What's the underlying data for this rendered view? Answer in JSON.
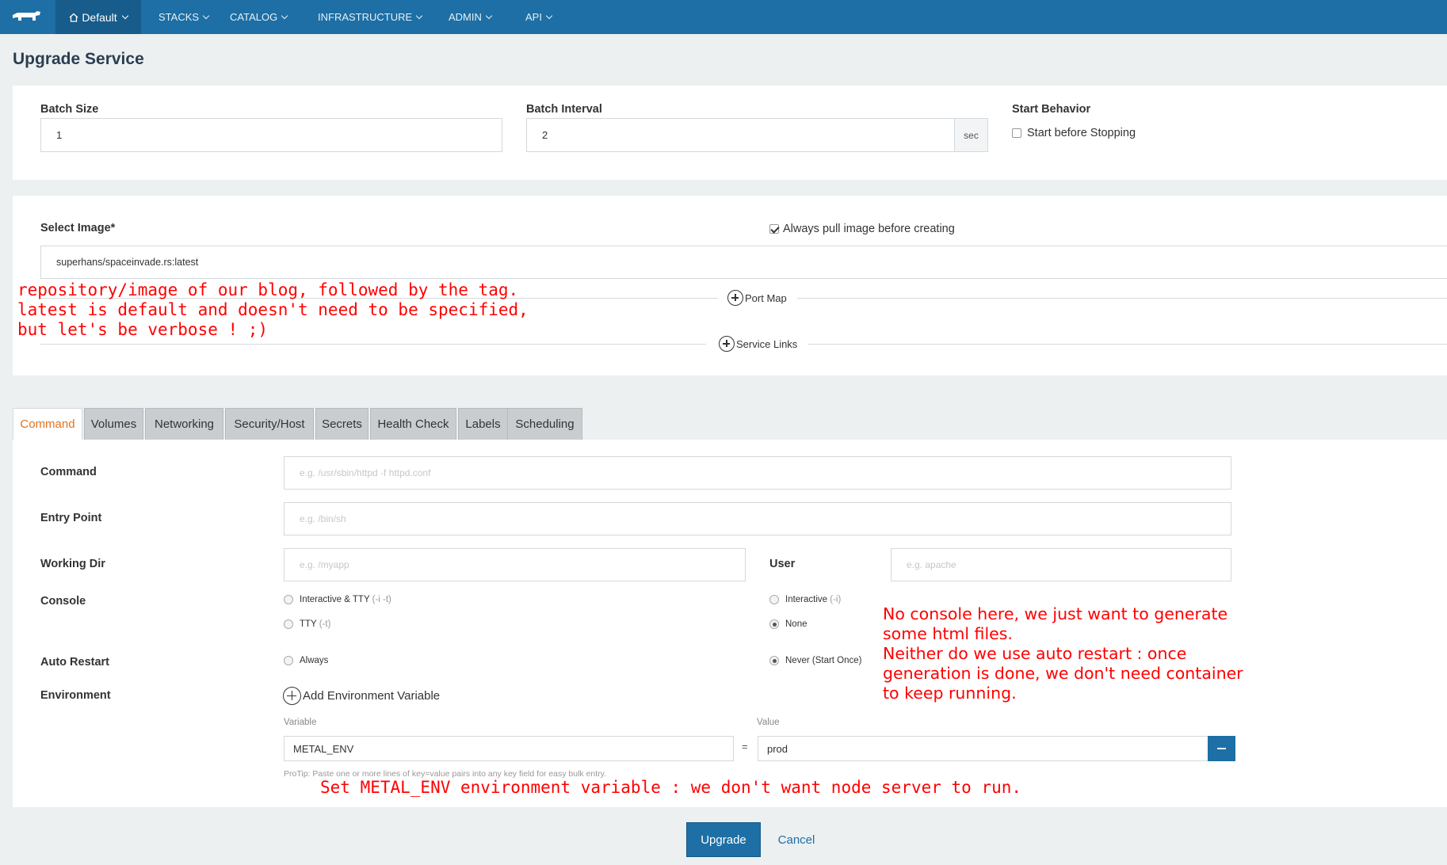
{
  "nav": {
    "environment": "Default",
    "items": [
      "STACKS",
      "CATALOG",
      "INFRASTRUCTURE",
      "ADMIN",
      "API"
    ]
  },
  "page_title": "Upgrade Service",
  "upgrade": {
    "batch_size_label": "Batch Size",
    "batch_size_value": "1",
    "batch_interval_label": "Batch Interval",
    "batch_interval_value": "2",
    "batch_interval_unit": "sec",
    "start_behavior_label": "Start Behavior",
    "start_before_stopping_label": "Start before Stopping",
    "start_before_stopping_checked": false
  },
  "image": {
    "label": "Select Image*",
    "value": "superhans/spaceinvade.rs:latest",
    "always_pull_label": "Always pull image before creating",
    "always_pull_checked": true,
    "port_map_label": "Port Map",
    "service_links_label": "Service Links"
  },
  "tabs": [
    "Command",
    "Volumes",
    "Networking",
    "Security/Host",
    "Secrets",
    "Health Check",
    "Labels",
    "Scheduling"
  ],
  "active_tab": "Command",
  "command": {
    "command_label": "Command",
    "command_placeholder": "e.g. /usr/sbin/httpd -f httpd.conf",
    "entry_point_label": "Entry Point",
    "entry_point_placeholder": "e.g. /bin/sh",
    "working_dir_label": "Working Dir",
    "working_dir_placeholder": "e.g. /myapp",
    "user_label": "User",
    "user_placeholder": "e.g. apache",
    "console_label": "Console",
    "console_options": [
      {
        "label": "Interactive & TTY",
        "hint": "(-i -t)",
        "selected": false
      },
      {
        "label": "Interactive",
        "hint": "(-i)",
        "selected": false
      },
      {
        "label": "TTY",
        "hint": "(-t)",
        "selected": false
      },
      {
        "label": "None",
        "hint": "",
        "selected": true
      }
    ],
    "auto_restart_label": "Auto Restart",
    "auto_restart_options": [
      {
        "label": "Always",
        "selected": false
      },
      {
        "label": "Never (Start Once)",
        "selected": true
      }
    ],
    "environment_label": "Environment",
    "add_env_label": "Add Environment Variable",
    "variable_header": "Variable",
    "value_header": "Value",
    "env_vars": [
      {
        "variable": "METAL_ENV",
        "value": "prod"
      }
    ],
    "equals": "=",
    "protip": "ProTip: Paste one or more lines of key=value pairs into any key field for easy bulk entry."
  },
  "annotations": {
    "image_note": "repository/image of our blog, followed by the tag.\nlatest is default and doesn't need to be specified,\nbut let's be verbose ! ;)",
    "console_note": "No console here, we just want to generate\nsome html files.\nNeither do we use auto restart : once\ngeneration is done, we don't need container\nto keep running.",
    "env_note": "Set METAL_ENV environment variable : we don't want node server to run."
  },
  "buttons": {
    "upgrade": "Upgrade",
    "cancel": "Cancel"
  },
  "colors": {
    "nav_bg": "#1d6fa5",
    "accent_tab": "#e2731f",
    "annotation": "#ff0000"
  }
}
